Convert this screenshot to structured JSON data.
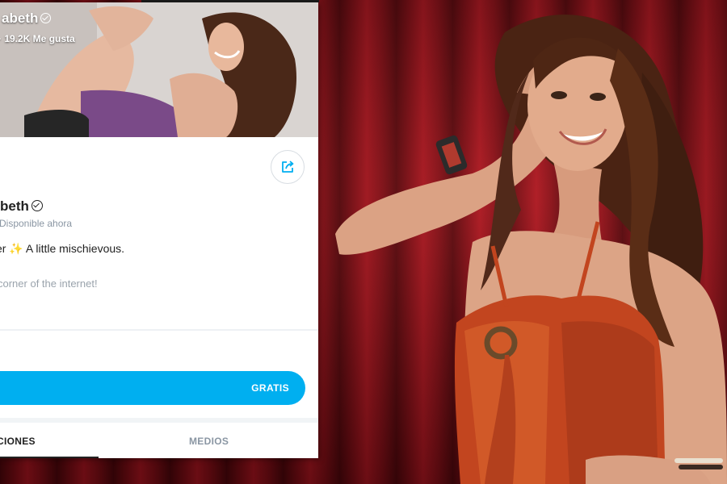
{
  "profile": {
    "cover_name": "abeth",
    "cover_stats": "· 19.2K Me gusta",
    "name": "beth",
    "status": "Disponible ahora",
    "bio_line1": "er ✨ A little mischievous.",
    "bio_line2": "corner of the internet!"
  },
  "subscribe": {
    "price_label": "GRATIS"
  },
  "tabs": [
    {
      "label": "CIONES"
    },
    {
      "label": "MEDIOS"
    }
  ],
  "colors": {
    "accent": "#00aff0",
    "curtain": "#8b0f18",
    "muted_text": "#8a96a3"
  },
  "icons": {
    "share": "share-icon",
    "verified": "verified-icon"
  }
}
